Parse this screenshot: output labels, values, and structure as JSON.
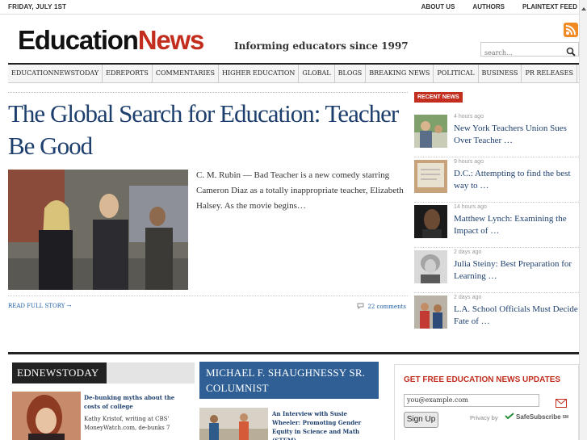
{
  "topbar": {
    "date": "FRIDAY, JULY 1ST",
    "links": [
      "ABOUT US",
      "AUTHORS",
      "PLAINTEXT FEED"
    ]
  },
  "masthead": {
    "logo_part1": "Education",
    "logo_part2": "News",
    "tagline": "Informing educators since 1997",
    "search_placeholder": "search...",
    "brand_color": "#c22d1e",
    "rss_color": "#f08a24"
  },
  "nav": {
    "items": [
      "EDUCATIONNEWSTODAY",
      "EDREPORTS",
      "COMMENTARIES",
      "HIGHER EDUCATION",
      "GLOBAL",
      "BLOGS",
      "BREAKING NEWS",
      "POLITICAL",
      "BUSINESS",
      "PR RELEASES"
    ]
  },
  "main": {
    "headline": "The Global Search for Education: Teacher Be Good",
    "excerpt": "C. M. Rubin — Bad Teacher is a new comedy starring Cameron Diaz as a totally inappropriate teacher, Elizabeth Halsey. As the movie begins…",
    "read_more": "READ FULL STORY →",
    "comments": "22 comments",
    "link_color": "#1d3f6e"
  },
  "recent": {
    "label": "RECENT NEWS",
    "items": [
      {
        "ago": "4 hours ago",
        "title": "New York Teachers Union Sues Over Teacher …"
      },
      {
        "ago": "9 hours ago",
        "title": "D.C.: Attempting to find the best way to …"
      },
      {
        "ago": "14 hours ago",
        "title": "Matthew Lynch: Examining the Impact of …"
      },
      {
        "ago": "2 days ago",
        "title": "Julia Steiny: Best Preparation for Learning …"
      },
      {
        "ago": "2 days ago",
        "title": "L.A. School Officials Must Decide Fate of …"
      }
    ]
  },
  "ednewstoday": {
    "header": "EDNEWSTODAY",
    "title": "De-bunking myths about the costs of college",
    "text": "Kathy Kristof, writing at CBS' MoneyWatch.com, de-bunks 7"
  },
  "columnist": {
    "header": "MICHAEL F. SHAUGHNESSY SR. COLUMNIST",
    "title": "An Interview with Susie Wheeler: Promoting Gender Equity in Science and Math (STEM)",
    "header_color": "#2f5f95"
  },
  "signup": {
    "heading": "GET FREE EDUCATION NEWS UPDATES",
    "email_value": "you@example.com",
    "button": "Sign Up",
    "privacy": "Privacy by",
    "safe": "SafeSubscribe",
    "safe_sup": "SM"
  }
}
